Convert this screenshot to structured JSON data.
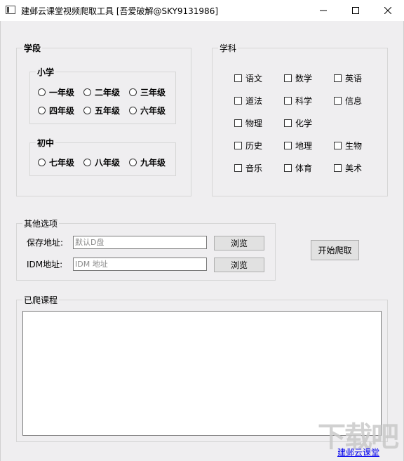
{
  "window": {
    "title": "建邺云课堂视频爬取工具 [吾爱破解@SKY9131986]",
    "controls": [
      "minimize",
      "maximize",
      "close"
    ]
  },
  "stage": {
    "title": "学段",
    "primary": {
      "title": "小学",
      "options": [
        "一年级",
        "二年级",
        "三年级",
        "四年级",
        "五年级",
        "六年级"
      ]
    },
    "middle": {
      "title": "初中",
      "options": [
        "七年级",
        "八年级",
        "九年级"
      ]
    }
  },
  "subject": {
    "title": "学科",
    "options": [
      "语文",
      "数学",
      "英语",
      "道法",
      "科学",
      "信息",
      "物理",
      "化学",
      "历史",
      "地理",
      "生物",
      "音乐",
      "体育",
      "美术"
    ]
  },
  "other": {
    "title": "其他选项",
    "save_label": "保存地址:",
    "save_placeholder": "默认D盘",
    "idm_label": "IDM地址:",
    "idm_placeholder": "IDM 地址",
    "browse_label": "浏览"
  },
  "start_label": "开始爬取",
  "courses": {
    "title": "已爬课程"
  },
  "footer_link": "建邺云课堂",
  "watermark": "下载吧",
  "colors": {
    "background": "#efeef0",
    "link": "#0000ee",
    "border": "#d6d6d6"
  }
}
